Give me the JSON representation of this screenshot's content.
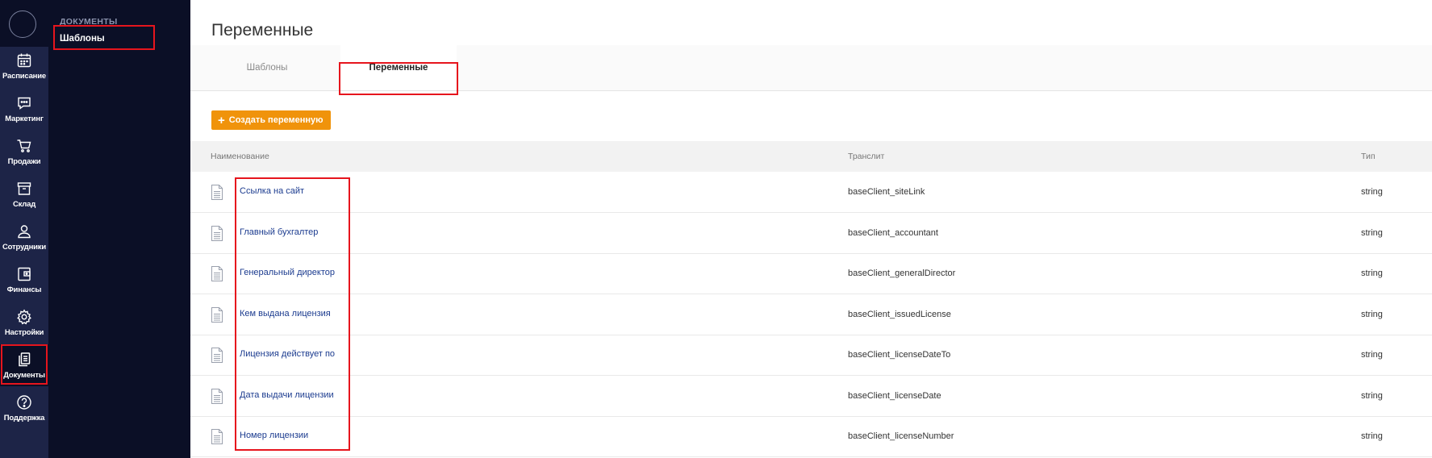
{
  "sidebar": {
    "items": [
      {
        "label": "Расписание",
        "icon": "calendar-icon"
      },
      {
        "label": "Маркетинг",
        "icon": "message-icon"
      },
      {
        "label": "Продажи",
        "icon": "cart-icon"
      },
      {
        "label": "Склад",
        "icon": "box-icon"
      },
      {
        "label": "Сотрудники",
        "icon": "user-icon"
      },
      {
        "label": "Финансы",
        "icon": "wallet-icon"
      },
      {
        "label": "Настройки",
        "icon": "gear-icon"
      },
      {
        "label": "Документы",
        "icon": "documents-icon",
        "active": true
      },
      {
        "label": "Поддержка",
        "icon": "help-icon"
      }
    ]
  },
  "submenu": {
    "title": "ДОКУМЕНТЫ",
    "items": [
      {
        "label": "Шаблоны"
      }
    ]
  },
  "page": {
    "title": "Переменные",
    "tabs": [
      {
        "label": "Шаблоны",
        "active": false
      },
      {
        "label": "Переменные",
        "active": true
      }
    ],
    "create_button": "Создать переменную"
  },
  "table": {
    "columns": [
      "Наименование",
      "Транслит",
      "Тип"
    ],
    "rows": [
      {
        "name": "Ссылка на сайт",
        "translit": "baseClient_siteLink",
        "type": "string"
      },
      {
        "name": "Главный бухгалтер",
        "translit": "baseClient_accountant",
        "type": "string"
      },
      {
        "name": "Генеральный директор",
        "translit": "baseClient_generalDirector",
        "type": "string"
      },
      {
        "name": "Кем выдана лицензия",
        "translit": "baseClient_issuedLicense",
        "type": "string"
      },
      {
        "name": "Лицензия действует по",
        "translit": "baseClient_licenseDateTo",
        "type": "string"
      },
      {
        "name": "Дата выдачи лицензии",
        "translit": "baseClient_licenseDate",
        "type": "string"
      },
      {
        "name": "Номер лицензии",
        "translit": "baseClient_licenseNumber",
        "type": "string"
      }
    ]
  },
  "colors": {
    "rail": "#1d2447",
    "submenu": "#0b0f26",
    "accent": "#f0930b",
    "link": "#1b3b8f",
    "highlight": "#e6151d"
  }
}
